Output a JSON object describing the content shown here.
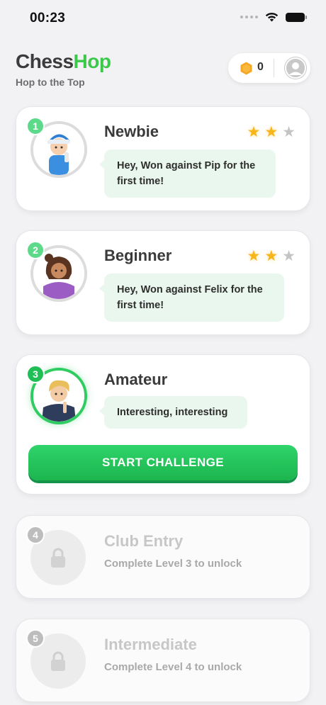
{
  "status_bar": {
    "time": "00:23"
  },
  "header": {
    "brand_part1": "Chess",
    "brand_part2": "Hop",
    "tagline": "Hop to the Top",
    "coins": "0"
  },
  "levels": [
    {
      "number": "1",
      "title": "Newbie",
      "stars_earned": 2,
      "stars_total": 3,
      "message": "Hey, Won against Pip for the first time!"
    },
    {
      "number": "2",
      "title": "Beginner",
      "stars_earned": 2,
      "stars_total": 3,
      "message": "Hey, Won against Felix for the first time!"
    },
    {
      "number": "3",
      "title": "Amateur",
      "message": "Interesting, interesting",
      "button_label": "START CHALLENGE"
    },
    {
      "number": "4",
      "title": "Club Entry",
      "subtitle": "Complete Level 3 to unlock"
    },
    {
      "number": "5",
      "title": "Intermediate",
      "subtitle": "Complete Level 4 to unlock"
    }
  ],
  "colors": {
    "accent": "#2ecc61",
    "brand_green": "#3cc84a",
    "star": "#f6b619",
    "coin": "#f5a623"
  }
}
